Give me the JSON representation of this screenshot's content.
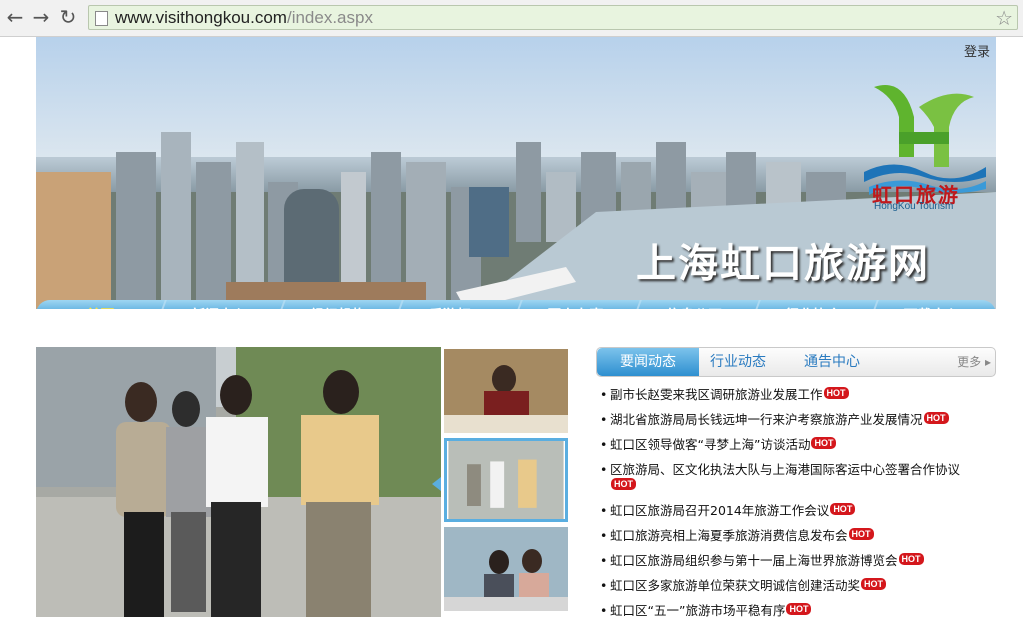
{
  "browser": {
    "url_host": "www.visithongkou.com",
    "url_path": "/index.aspx",
    "back_icon": "arrow-left-icon",
    "forward_icon": "arrow-right-icon",
    "reload_icon": "reload-icon",
    "bookmark_icon": "star-icon"
  },
  "header": {
    "login": "登录",
    "logo_cn": "虹口旅游",
    "logo_en": "HongKou Tourism",
    "site_title": "上海虹口旅游网"
  },
  "nav": [
    {
      "label": "首页",
      "active": true
    },
    {
      "label": "新闻中心"
    },
    {
      "label": "组织机构"
    },
    {
      "label": "乐游虹口"
    },
    {
      "label": "网上办事"
    },
    {
      "label": "信息公开"
    },
    {
      "label": "行业协会"
    },
    {
      "label": "下载中心"
    }
  ],
  "news": {
    "tabs": [
      "要闻动态",
      "行业动态",
      "通告中心"
    ],
    "more": "更多",
    "hot_label": "HOT",
    "items": [
      "副市长赵雯来我区调研旅游业发展工作",
      "湖北省旅游局局长钱远坤一行来沪考察旅游产业发展情况",
      "虹口区领导做客“寻梦上海”访谈活动",
      "区旅游局、区文化执法大队与上海港国际客运中心签署合作协议",
      "虹口区旅游局召开2014年旅游工作会议",
      "虹口旅游亮相上海夏季旅游消费信息发布会",
      "虹口区旅游局组织参与第十一届上海世界旅游博览会",
      "虹口区多家旅游单位荣获文明诚信创建活动奖",
      "虹口区“五一”旅游市场平稳有序"
    ]
  },
  "colors": {
    "nav_blue": "#2a86c6",
    "active_nav": "#ffe23a",
    "hot_red": "#d4171c",
    "tab_blue": "#2e8fd0"
  }
}
